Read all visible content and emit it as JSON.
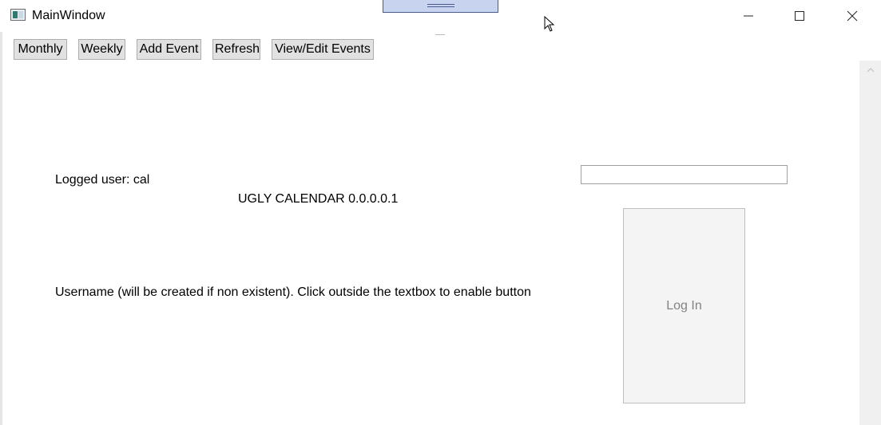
{
  "window": {
    "title": "MainWindow",
    "minimize_glyph": "—",
    "maximize_glyph": "☐",
    "close_glyph": "✕"
  },
  "toolbar": {
    "monthly_label": "Monthly",
    "weekly_label": "Weekly",
    "add_event_label": "Add Event",
    "refresh_label": "Refresh",
    "view_edit_label": "View/Edit Events"
  },
  "main": {
    "logged_user": "Logged user: cal",
    "app_title": "UGLY CALENDAR 0.0.0.0.1",
    "username_hint": "Username (will be created if non existent). Click outside the textbox to enable button",
    "username_value": "",
    "login_label": "Log In"
  },
  "icons": {
    "app": "window-app-icon",
    "scroll_up": "scroll-up-arrow-icon",
    "cursor": "mouse-pointer-icon"
  }
}
